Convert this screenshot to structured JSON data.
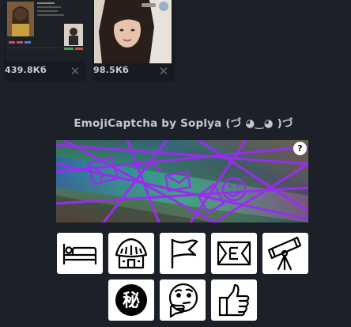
{
  "attachments": [
    {
      "size": "439.8Кб",
      "close": "✕",
      "thumbnail": "screenshot-preview"
    },
    {
      "size": "98.5Кб",
      "close": "✕",
      "thumbnail": "photo-preview"
    }
  ],
  "captcha": {
    "title": "EmojiCaptcha by Soplya (づ ◕‿◕ )づ",
    "help_label": "?",
    "choices": [
      {
        "icon": "bed-icon"
      },
      {
        "icon": "hut-icon"
      },
      {
        "icon": "flag-icon"
      },
      {
        "icon": "envelope-icon"
      },
      {
        "icon": "telescope-icon"
      },
      {
        "icon": "secret-icon",
        "glyph": "秘"
      },
      {
        "icon": "thinking-face-icon"
      },
      {
        "icon": "thumbs-up-icon"
      }
    ]
  }
}
